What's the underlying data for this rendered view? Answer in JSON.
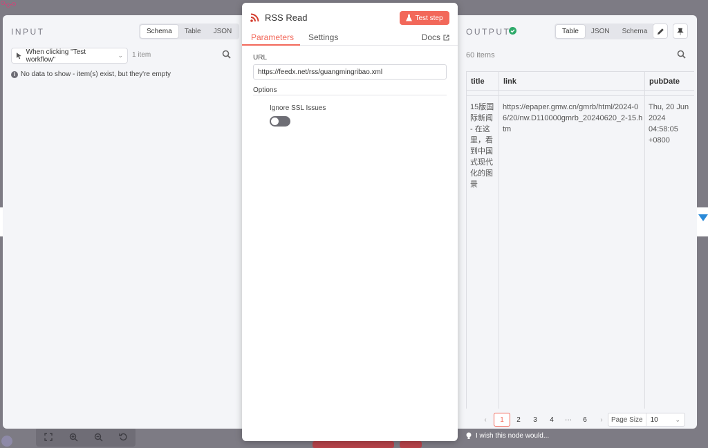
{
  "input": {
    "title": "INPUT",
    "view_options": [
      "Schema",
      "Table",
      "JSON"
    ],
    "active_view": "Schema",
    "trigger_select": "When clicking \"Test workflow\"",
    "item_count": "1 item",
    "empty_message": "No data to show - item(s) exist, but they're empty"
  },
  "node": {
    "title": "RSS Read",
    "test_button": "Test step",
    "tabs": [
      "Parameters",
      "Settings"
    ],
    "active_tab": "Parameters",
    "docs_link": "Docs",
    "url_label": "URL",
    "url_value": "https://feedx.net/rss/guangmingribao.xml",
    "options_label": "Options",
    "ignore_ssl_label": "Ignore SSL Issues",
    "ignore_ssl_value": false,
    "accent_color": "#f2685a"
  },
  "output": {
    "title": "OUTPUT",
    "status": "success",
    "view_options": [
      "Table",
      "JSON",
      "Schema"
    ],
    "active_view": "Table",
    "item_count": "60 items",
    "columns": [
      "title",
      "link",
      "pubDate"
    ],
    "rows": [
      {
        "title": "15版国际新闻 - 在这里，看到中国式现代化的图景",
        "link": "https://epaper.gmw.cn/gmrb/html/2024-06/20/nw.D110000gmrb_20240620_2-15.htm",
        "pubDate": "Thu, 20 Jun 2024 04:58:05 +0800"
      }
    ],
    "pagination": {
      "prev": "‹",
      "pages": [
        "1",
        "2",
        "3",
        "4",
        "···",
        "6"
      ],
      "current": "1",
      "next": "›",
      "page_size_label": "Page Size",
      "page_size_value": "10"
    }
  },
  "feedback": "I wish this node would..."
}
